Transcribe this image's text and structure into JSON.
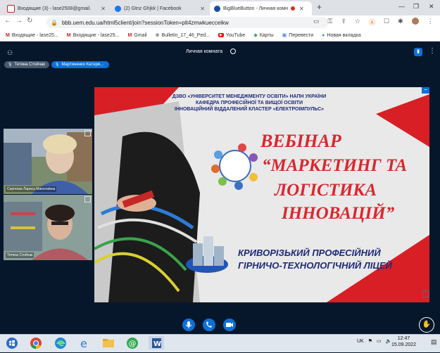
{
  "browser": {
    "tabs": [
      {
        "label": "Входящие (3) - lase2508@gmail.",
        "icon": "gmail-icon"
      },
      {
        "label": "(2) Gtnz Ghjkk | Facebook",
        "icon": "facebook-icon"
      },
      {
        "label": "BigBlueButton - Личная комн",
        "icon": "bigbluebutton-icon",
        "active": true
      }
    ],
    "url": "bbb.uem.edu.ua/html5client/join?sessionToken=plt4zmwkuecceikw",
    "bookmarks": [
      "Входящие - lase25...",
      "Входящие - lase25...",
      "Gmail",
      "Bulletin_17_46_Ped...",
      "YouTube",
      "Карты",
      "Перевести",
      "Новая вкладка"
    ]
  },
  "meeting": {
    "room_title": "Личная комната",
    "talkers": [
      "Тетяна Стойчак",
      "Мартиненко Катери..."
    ],
    "webcams": [
      {
        "name": "Сергеєва Лариса Миколаївна"
      },
      {
        "name": "Тетяна Стойчак"
      }
    ]
  },
  "slide": {
    "header_lines": [
      "ДЗВО «УНІВЕРСИТЕТ МЕНЕДЖМЕНТУ ОСВІТИ» НАПН УКРАЇНИ",
      "КАФЕДРА ПРОФЕСІЙНОЇ ТА ВИЩОЇ ОСВІТИ",
      "ІННОВАЦІЙНИЙ ВІДДАЛЕНИЙ КЛАСТЕР «ЕЛЕКТРОІМПУЛЬС»"
    ],
    "title_line1": "ВЕБІНАР",
    "title_line2": "“МАРКЕТИНГ ТА",
    "title_line3": "ЛОГІСТИКА",
    "title_line4": "ІННОВАЦІЙ”",
    "school_line1": "КРИВОРІЗЬКИЙ ПРОФЕСІЙНИЙ",
    "school_line2": "ГІРНИЧО-ТЕХНОЛОГІЧНИЙ ЛІЦЕЙ"
  },
  "taskbar": {
    "language": "UK",
    "time": "12:47",
    "date": "15.09.2022"
  },
  "colors": {
    "bbb_dark": "#06172b",
    "bbb_blue": "#0f70d7",
    "slide_red": "#d81f26",
    "slide_title": "#d9272e",
    "slide_navy": "#1e2a78"
  }
}
